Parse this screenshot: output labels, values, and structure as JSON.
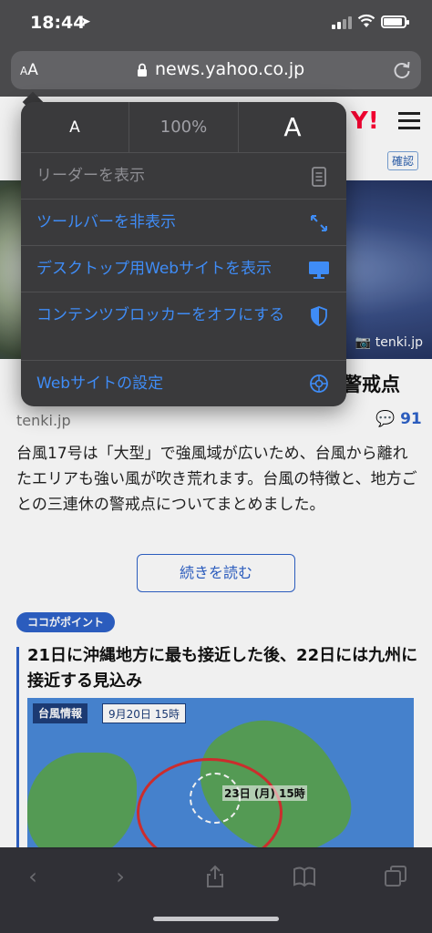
{
  "status": {
    "time": "18:44",
    "location_glyph": "➤"
  },
  "browser": {
    "aa_label_small": "A",
    "aa_label_large": "A",
    "url": "news.yahoo.co.jp"
  },
  "page": {
    "yahoo_logo": "Y!",
    "confirm_badge": "確認",
    "hero_credit": "tenki.jp",
    "headline_tail": "警戒点",
    "source": "tenki.jp",
    "comment_count": "91",
    "summary": "台風17号は「大型」で強風域が広いため、台風から離れたエリアも強い風が吹き荒れます。台風の特徴と、地方ごとの三連休の警戒点についてまとめました。",
    "read_more": "続きを読む",
    "point_badge": "ココがポイント",
    "point_text": "21日に沖縄地方に最も接近した後、22日には九州に接近する見込み",
    "map_title": "台風情報",
    "map_date": "9月20日 15時",
    "map_label": "23日 (月) 15時"
  },
  "popup": {
    "zoom_small": "A",
    "zoom_percent": "100%",
    "zoom_large": "A",
    "items": [
      {
        "label": "リーダーを表示",
        "icon": "reader-icon",
        "enabled": false
      },
      {
        "label": "ツールバーを非表示",
        "icon": "expand-arrows-icon",
        "enabled": true
      },
      {
        "label": "デスクトップ用Webサイトを表示",
        "icon": "desktop-icon",
        "enabled": true
      },
      {
        "label": "コンテンツブロッカーをオフにする",
        "icon": "shield-icon",
        "enabled": true
      },
      {
        "label": "Webサイトの設定",
        "icon": "gear-icon",
        "enabled": true
      }
    ]
  },
  "colors": {
    "accent": "#3f8cf6",
    "popup_bg": "#3a3a3c",
    "yahoo_red": "#ff0033"
  }
}
